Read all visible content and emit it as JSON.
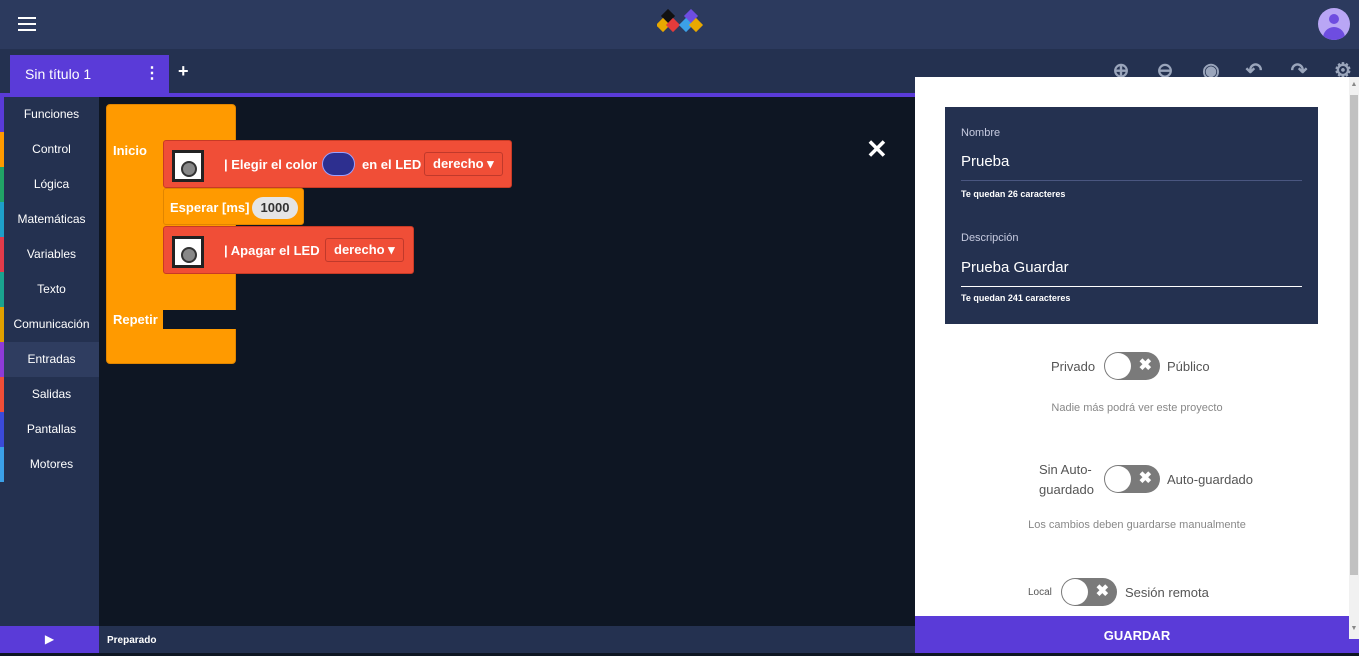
{
  "app": {
    "menu_icon": "hamburger-icon",
    "logo": "app-logo",
    "avatar_icon": "user-avatar-icon"
  },
  "tab": {
    "title": "Sin título 1",
    "menu_icon": "more-vert-icon",
    "add": "+"
  },
  "toolbar": {
    "icons": [
      "zoom-in-icon",
      "zoom-out-icon",
      "center-icon",
      "undo-icon",
      "redo-icon",
      "settings-icon"
    ]
  },
  "categories": [
    {
      "label": "Funciones",
      "color": "#5a3bd8"
    },
    {
      "label": "Control",
      "color": "#ff9a00"
    },
    {
      "label": "Lógica",
      "color": "#21a366"
    },
    {
      "label": "Matemáticas",
      "color": "#1ea0c9"
    },
    {
      "label": "Variables",
      "color": "#e23b4a"
    },
    {
      "label": "Texto",
      "color": "#1aa38f"
    },
    {
      "label": "Comunicación",
      "color": "#e0a000"
    },
    {
      "label": "Entradas",
      "color": "#8e3bd8"
    },
    {
      "label": "Salidas",
      "color": "#f04e37"
    },
    {
      "label": "Pantallas",
      "color": "#3b4ad8"
    },
    {
      "label": "Motores",
      "color": "#3ba0e8"
    }
  ],
  "blocks": {
    "inicio": "Inicio",
    "repetir": "Repetir",
    "led_color": {
      "text": "| Elegir el color",
      "suffix": "en el LED",
      "dropdown": "derecho ▾",
      "color": "#2d2f8f"
    },
    "wait": {
      "text": "Esperar [ms]",
      "value": "1000"
    },
    "led_off": {
      "text": "| Apagar el LED",
      "dropdown": "derecho ▾"
    }
  },
  "status": {
    "play_icon": "play-icon",
    "text": "Preparado"
  },
  "panel": {
    "name_label": "Nombre",
    "name_value": "Prueba",
    "name_hint": "Te quedan 26 caracteres",
    "desc_label": "Descripción",
    "desc_value": "Prueba Guardar",
    "desc_hint": "Te quedan 241 caracteres",
    "privacy": {
      "left": "Privado",
      "right": "Público",
      "note": "Nadie más podrá ver este proyecto"
    },
    "autosave": {
      "left_line1": "Sin Auto-",
      "left_line2": "guardado",
      "right": "Auto-guardado",
      "note": "Los cambios deben guardarse manualmente"
    },
    "session": {
      "left": "Local",
      "right": "Sesión remota"
    },
    "save": "GUARDAR"
  }
}
